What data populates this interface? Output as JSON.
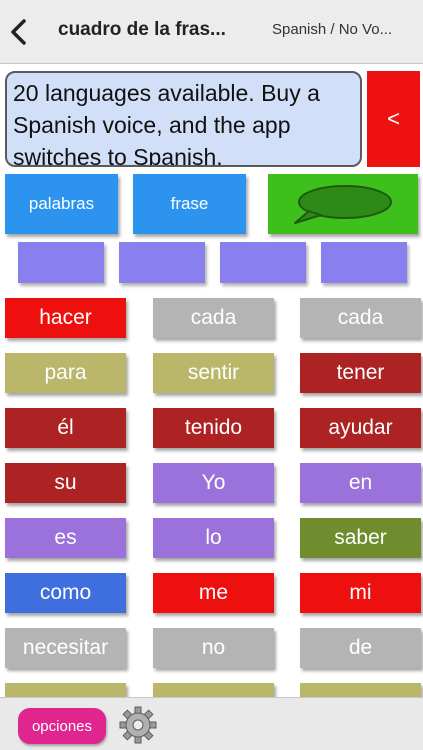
{
  "navbar": {
    "title": "cuadro de la fras...",
    "voice_label": "Spanish / No Vo...",
    "back_icon": "chevron-left-icon"
  },
  "message": {
    "text": "20 languages available. Buy a Spanish voice, and the app switches to Spanish.",
    "backspace_label": "<"
  },
  "modes": {
    "words_label": "palabras",
    "phrase_label": "frase",
    "speak_icon": "speech-bubble-icon"
  },
  "slots_count": 4,
  "colors": {
    "red": "#ee0f0f",
    "grey": "#b4b4b4",
    "olive": "#bab66a",
    "dark_red": "#ad2323",
    "purple": "#9b72db",
    "green": "#6f8c2e",
    "blue": "#3f6fde",
    "speak_green": "#3ec01c",
    "mode_blue": "#2c94ef",
    "options_pink": "#e0258f",
    "slot_violet": "#8a7fef"
  },
  "word_grid": [
    [
      {
        "text": "hacer",
        "color": "red"
      },
      {
        "text": "cada",
        "color": "grey"
      },
      {
        "text": "cada",
        "color": "grey"
      }
    ],
    [
      {
        "text": "para",
        "color": "olive"
      },
      {
        "text": "sentir",
        "color": "olive"
      },
      {
        "text": "tener",
        "color": "dark_red"
      }
    ],
    [
      {
        "text": "él",
        "color": "dark_red"
      },
      {
        "text": "tenido",
        "color": "dark_red"
      },
      {
        "text": "ayudar",
        "color": "dark_red"
      }
    ],
    [
      {
        "text": "su",
        "color": "dark_red"
      },
      {
        "text": "Yo",
        "color": "purple"
      },
      {
        "text": "en",
        "color": "purple"
      }
    ],
    [
      {
        "text": "es",
        "color": "purple"
      },
      {
        "text": "lo",
        "color": "purple"
      },
      {
        "text": "saber",
        "color": "green"
      }
    ],
    [
      {
        "text": "como",
        "color": "blue"
      },
      {
        "text": "me",
        "color": "red"
      },
      {
        "text": "mi",
        "color": "red"
      }
    ],
    [
      {
        "text": "necesitar",
        "color": "grey"
      },
      {
        "text": "no",
        "color": "grey"
      },
      {
        "text": "de",
        "color": "grey"
      }
    ],
    [
      {
        "text": "",
        "color": "olive"
      },
      {
        "text": "",
        "color": "olive"
      },
      {
        "text": "",
        "color": "olive"
      }
    ]
  ],
  "bottom": {
    "options_label": "opciones",
    "settings_icon": "gear-icon"
  }
}
